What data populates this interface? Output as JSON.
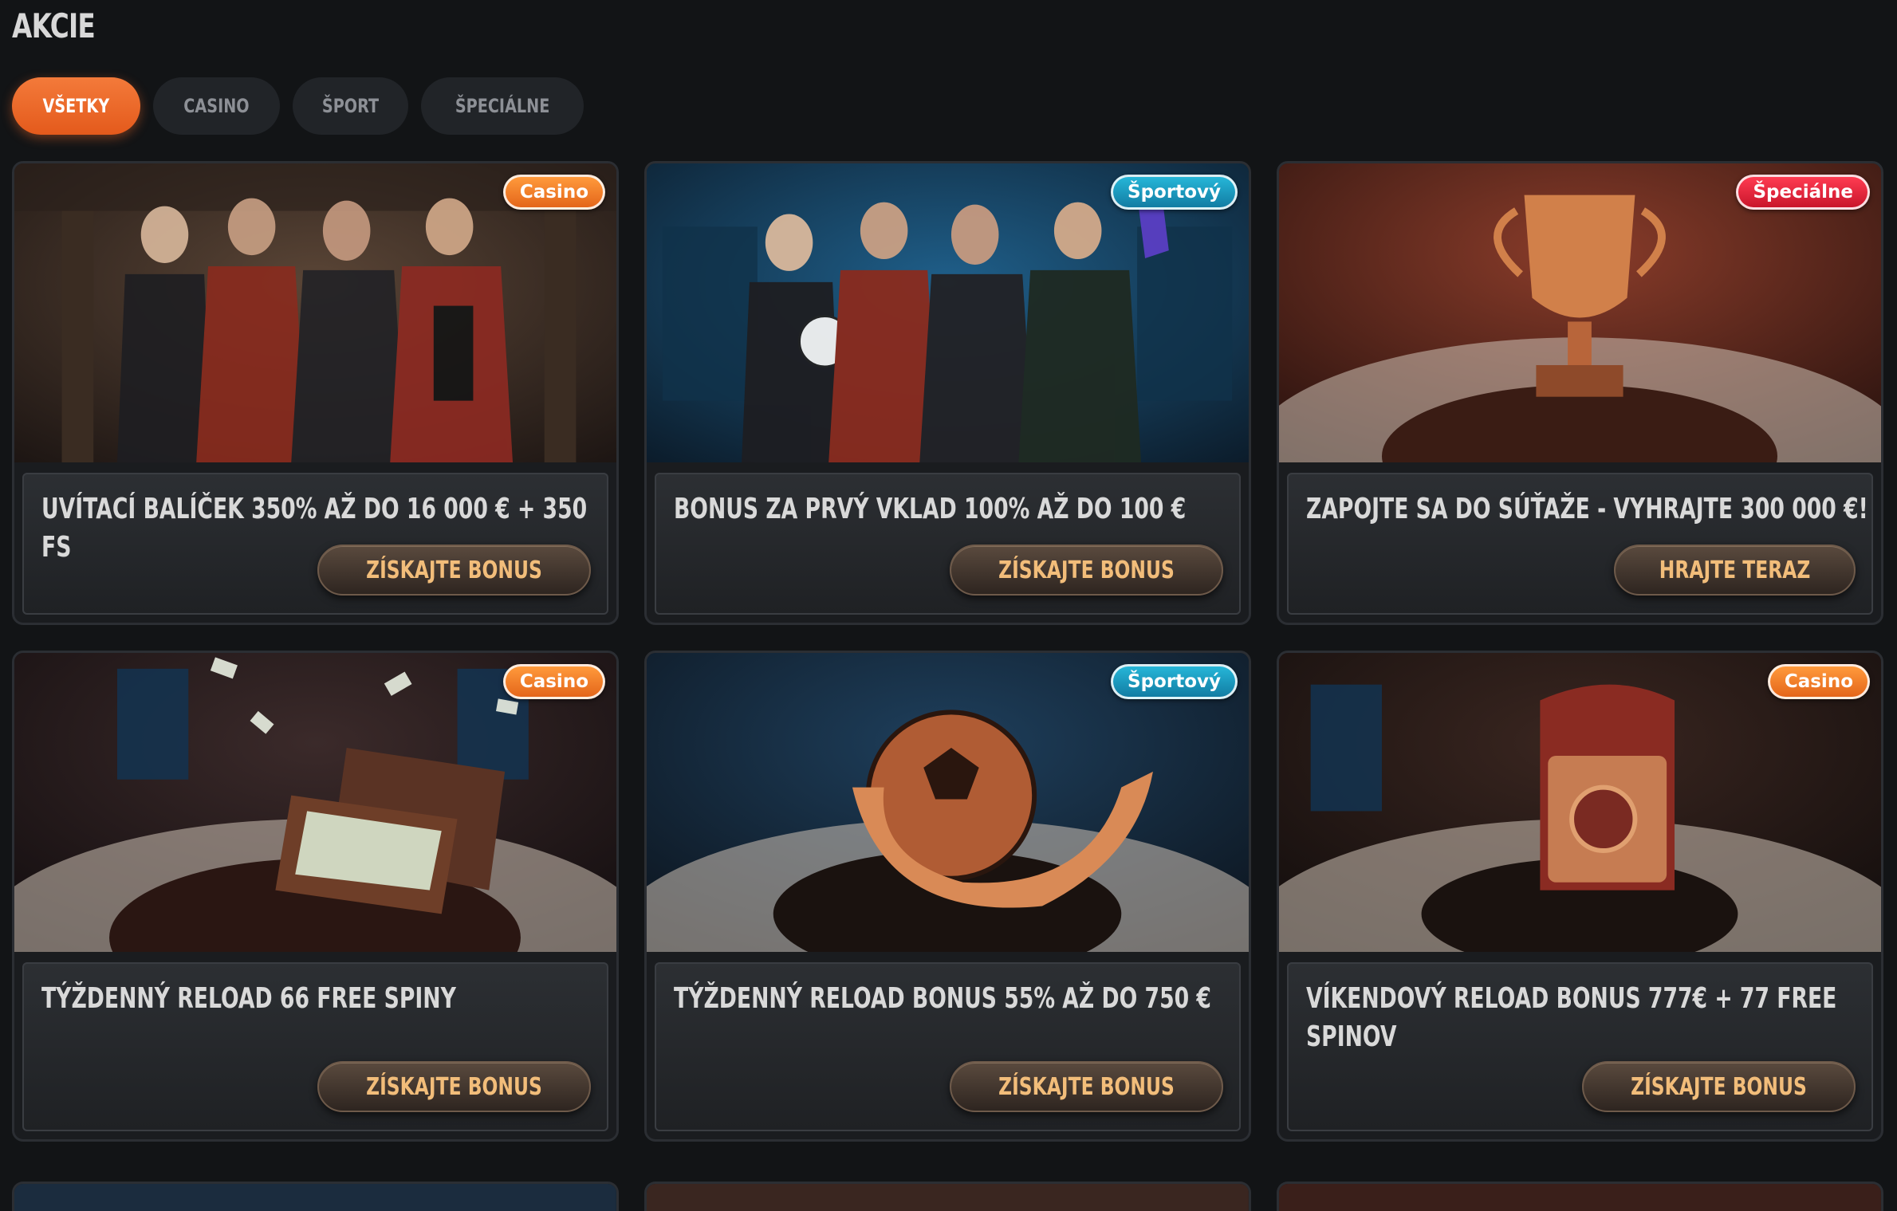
{
  "page": {
    "title": "AKCIE"
  },
  "tabs": [
    {
      "label": "VŠETKY",
      "active": true
    },
    {
      "label": "CASINO",
      "active": false
    },
    {
      "label": "ŠPORT",
      "active": false
    },
    {
      "label": "ŠPECIÁLNE",
      "active": false
    }
  ],
  "promotions": [
    {
      "badge": "Casino",
      "title": "UVÍTACÍ BALÍČEK 350% AŽ DO 16 000 € + 350 FS",
      "cta": "ZÍSKAJTE BONUS"
    },
    {
      "badge": "Športový",
      "title": "BONUS ZA PRVÝ VKLAD 100% AŽ DO 100 €",
      "cta": "ZÍSKAJTE BONUS"
    },
    {
      "badge": "Špeciálne",
      "title": "ZAPOJTE SA DO SÚŤAŽE - VYHRAJTE 300 000 €!",
      "cta": "HRAJTE TERAZ"
    },
    {
      "badge": "Casino",
      "title": "TÝŽDENNÝ RELOAD 66 FREE SPINY",
      "cta": "ZÍSKAJTE BONUS"
    },
    {
      "badge": "Športový",
      "title": "TÝŽDENNÝ RELOAD BONUS 55% AŽ DO 750 €",
      "cta": "ZÍSKAJTE BONUS"
    },
    {
      "badge": "Casino",
      "title": "VÍKENDOVÝ RELOAD BONUS 777€ + 77 FREE SPINOV",
      "cta": "ZÍSKAJTE BONUS"
    }
  ],
  "colors": {
    "background": "#121416",
    "accent": "#e9662a",
    "badge_casino": "#ee7a26",
    "badge_sport": "#1a98c0",
    "badge_special": "#e22338",
    "cta_text": "#f2bd7a"
  }
}
